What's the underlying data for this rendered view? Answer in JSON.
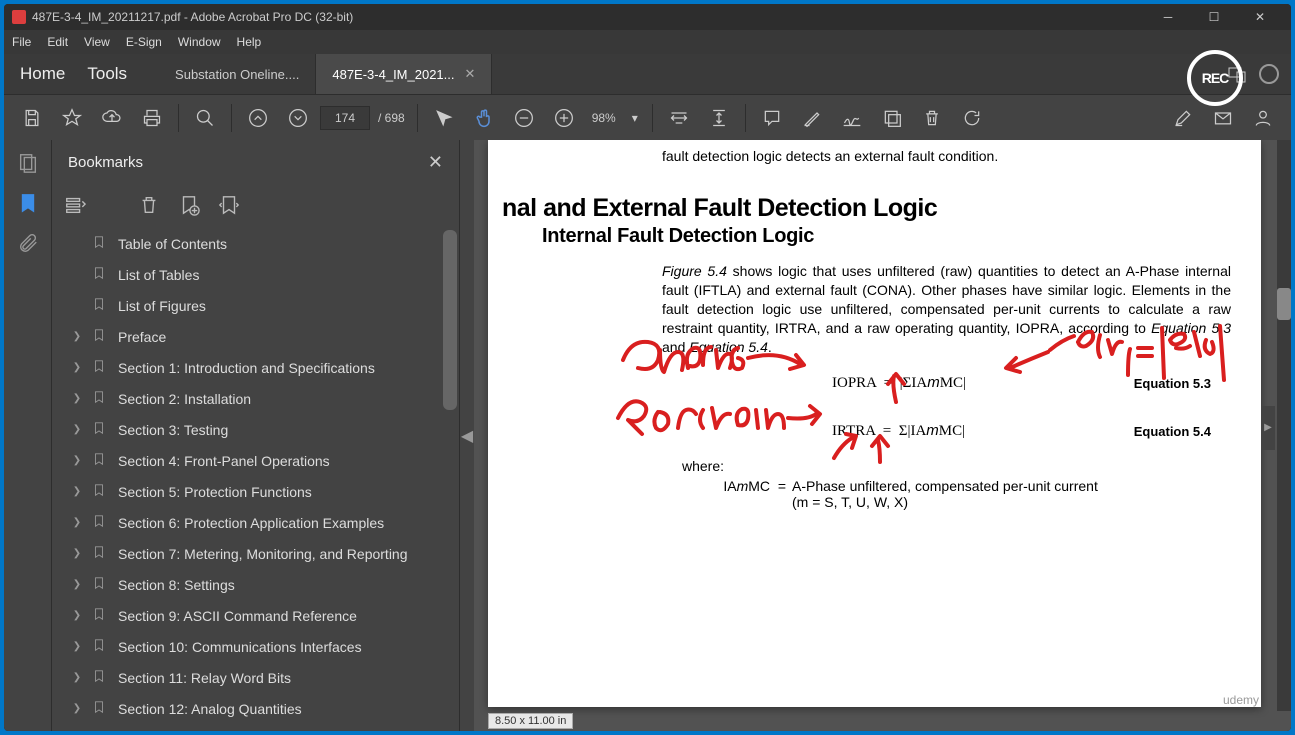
{
  "titlebar": {
    "title": "487E-3-4_IM_20211217.pdf - Adobe Acrobat Pro DC (32-bit)"
  },
  "menubar": {
    "items": [
      "File",
      "Edit",
      "View",
      "E-Sign",
      "Window",
      "Help"
    ]
  },
  "secondbar": {
    "home": "Home",
    "tools": "Tools",
    "tabs": [
      {
        "label": "Substation Oneline....",
        "active": false
      },
      {
        "label": "487E-3-4_IM_2021...",
        "active": true
      }
    ],
    "rec": "REC"
  },
  "toolbar": {
    "page_current": "174",
    "page_total": "698",
    "zoom": "98%"
  },
  "sidebar": {
    "title": "Bookmarks",
    "items": [
      {
        "label": "Table of Contents",
        "expandable": false
      },
      {
        "label": "List of Tables",
        "expandable": false
      },
      {
        "label": "List of Figures",
        "expandable": false
      },
      {
        "label": "Preface",
        "expandable": true
      },
      {
        "label": "Section 1: Introduction and Specifications",
        "expandable": true
      },
      {
        "label": "Section 2: Installation",
        "expandable": true
      },
      {
        "label": "Section 3: Testing",
        "expandable": true
      },
      {
        "label": "Section 4: Front-Panel Operations",
        "expandable": true
      },
      {
        "label": "Section 5: Protection Functions",
        "expandable": true
      },
      {
        "label": "Section 6: Protection Application Examples",
        "expandable": true
      },
      {
        "label": "Section 7: Metering, Monitoring, and Reporting",
        "expandable": true
      },
      {
        "label": "Section 8: Settings",
        "expandable": true
      },
      {
        "label": "Section 9: ASCII Command Reference",
        "expandable": true
      },
      {
        "label": "Section 10: Communications Interfaces",
        "expandable": true
      },
      {
        "label": "Section 11: Relay Word Bits",
        "expandable": true
      },
      {
        "label": "Section 12: Analog Quantities",
        "expandable": true
      }
    ]
  },
  "document": {
    "top_fragment": "fault detection logic detects an external fault condition.",
    "heading_main": "nal and External Fault Detection Logic",
    "heading_sub": "Internal Fault Detection Logic",
    "paragraph": "Figure 5.4 shows logic that uses unfiltered (raw) quantities to detect an A-Phase internal fault (IFTLA) and external fault (CONA). Other phases have similar logic. Elements in the fault detection logic use unfiltered, compensated per-unit currents to calculate a raw restraint quantity, IRTRA, and a raw operating quantity, IOPRA, according to Equation 5.3 and Equation 5.4.",
    "eq1": "IOPRA  =  |ΣIAmMC|",
    "eq1_label": "Equation 5.3",
    "eq2": "IRTRA  =  Σ|IAmMC|",
    "eq2_label": "Equation 5.4",
    "where": "where:",
    "where_term": "IAmMC  =",
    "where_desc1": "A-Phase unfiltered, compensated per-unit current",
    "where_desc2": "(m = S, T, U, W, X)",
    "page_size": "8.50 x 11.00 in"
  },
  "annotations": {
    "operating": "Operating",
    "restraining": "Restraining"
  },
  "watermark": "udemy"
}
